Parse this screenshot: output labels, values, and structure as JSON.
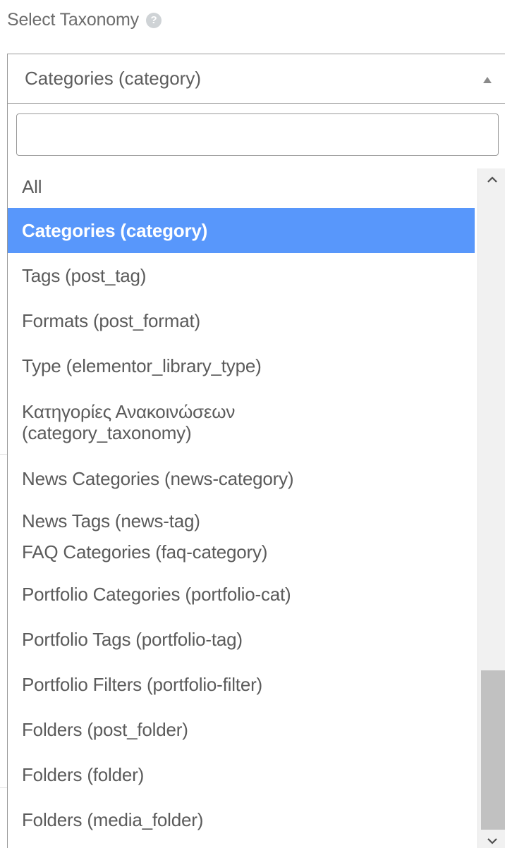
{
  "label": {
    "text": "Select Taxonomy",
    "help_icon": "?"
  },
  "select": {
    "selected_value": "Categories (category)",
    "arrow_icon": "triangle-up"
  },
  "search": {
    "value": "",
    "placeholder": ""
  },
  "options": [
    {
      "label": "All",
      "selected": false
    },
    {
      "label": "Categories (category)",
      "selected": true
    },
    {
      "label": "Tags (post_tag)",
      "selected": false
    },
    {
      "label": "Formats (post_format)",
      "selected": false
    },
    {
      "label": "Type (elementor_library_type)",
      "selected": false
    },
    {
      "label": "Κατηγορίες Ανακοινώσεων (category_taxonomy)",
      "selected": false
    },
    {
      "label": "News Categories (news-category)",
      "selected": false
    },
    {
      "label": "News Tags (news-tag)",
      "selected": false
    },
    {
      "label": "FAQ Categories (faq-category)",
      "selected": false
    },
    {
      "label": "Portfolio Categories (portfolio-cat)",
      "selected": false
    },
    {
      "label": "Portfolio Tags (portfolio-tag)",
      "selected": false
    },
    {
      "label": "Portfolio Filters (portfolio-filter)",
      "selected": false
    },
    {
      "label": "Folders (post_folder)",
      "selected": false
    },
    {
      "label": "Folders (folder)",
      "selected": false
    },
    {
      "label": "Folders (media_folder)",
      "selected": false
    }
  ],
  "scrollbar": {
    "up_icon": "^",
    "down_icon": "v"
  },
  "colors": {
    "selected_bg": "#5897fb",
    "selected_text": "#ffffff",
    "border": "#9a9a9a"
  }
}
